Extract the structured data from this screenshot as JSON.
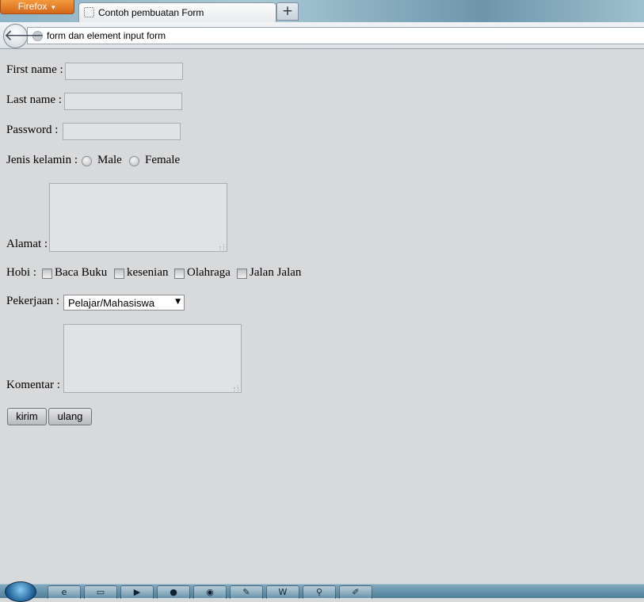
{
  "browser": {
    "app_button": "Firefox",
    "tab_title": "Contoh pembuatan Form",
    "new_tab": "+",
    "url": "form dan element input form"
  },
  "form": {
    "first_name_label": "First name :",
    "last_name_label": "Last name :",
    "password_label": "Password :",
    "gender_label": "Jenis kelamin :",
    "gender_options": [
      "Male",
      "Female"
    ],
    "address_label": "Alamat :",
    "hobby_label": "Hobi :",
    "hobby_options": [
      "Baca Buku",
      "kesenian",
      "Olahraga",
      "Jalan Jalan"
    ],
    "job_label": "Pekerjaan :",
    "job_selected": "Pelajar/Mahasiswa",
    "comment_label": "Komentar :",
    "submit_label": "kirim",
    "reset_label": "ulang"
  },
  "taskbar": {
    "items": [
      "internet-explorer-icon",
      "folder-icon",
      "media-player-icon",
      "firefox-icon",
      "chrome-icon",
      "paint-icon",
      "word-icon",
      "search-app-icon",
      "notepad-icon"
    ]
  }
}
